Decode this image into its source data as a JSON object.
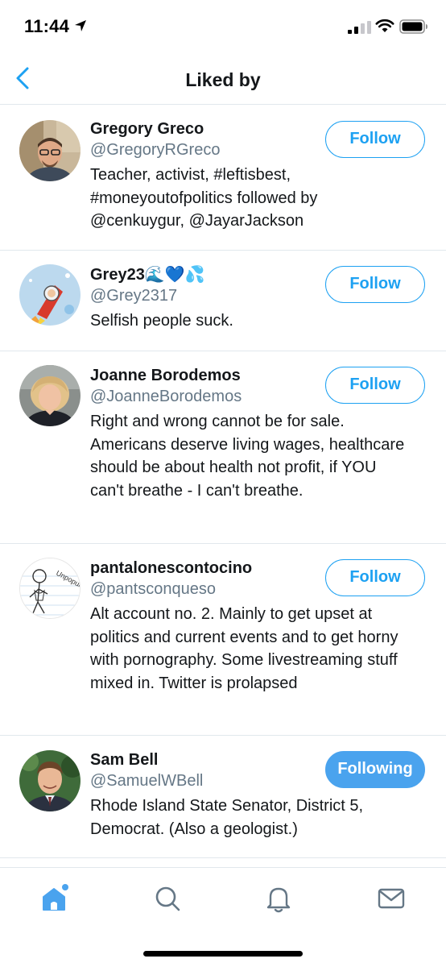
{
  "status_bar": {
    "time": "11:44"
  },
  "header": {
    "title": "Liked by"
  },
  "users": [
    {
      "name": "Gregory Greco",
      "handle": "@GregoryRGreco",
      "bio": "Teacher, activist, #leftisbest, #moneyoutofpolitics followed by @cenkuygur, @JayarJackson",
      "button": "Follow",
      "avatar_icon": "avatar-photo"
    },
    {
      "name": "Grey23🌊💙💦",
      "handle": "@Grey2317",
      "bio": "Selfish people suck.",
      "button": "Follow",
      "avatar_icon": "avatar-photo"
    },
    {
      "name": "Joanne Borodemos",
      "handle": "@JoanneBorodemos",
      "bio": "Right and wrong cannot be for sale. Americans deserve living wages, healthcare should be about health not profit, if YOU can't breathe - I can't breathe.",
      "button": "Follow",
      "avatar_icon": "avatar-photo"
    },
    {
      "name": "pantalonescontocino",
      "handle": "@pantsconqueso",
      "bio": "Alt account no. 2. Mainly to get upset at politics and current events and to get horny with pornography. Some livestreaming stuff mixed in. Twitter is prolapsed",
      "button": "Follow",
      "avatar_icon": "avatar-drawing",
      "avatar_text": "Unpopular."
    },
    {
      "name": "Sam Bell",
      "handle": "@SamuelWBell",
      "bio": "Rhode Island State Senator, District 5, Democrat. (Also a geologist.)",
      "button": "Following",
      "avatar_icon": "avatar-photo"
    }
  ],
  "tab_bar": {
    "tabs": [
      "home-icon",
      "search-icon",
      "bell-icon",
      "mail-icon"
    ],
    "active": "home-icon"
  },
  "colors": {
    "accent": "#1da1f2",
    "following_fill": "#4aa3ee",
    "handle": "#657786",
    "divider": "#e1e8ed"
  }
}
